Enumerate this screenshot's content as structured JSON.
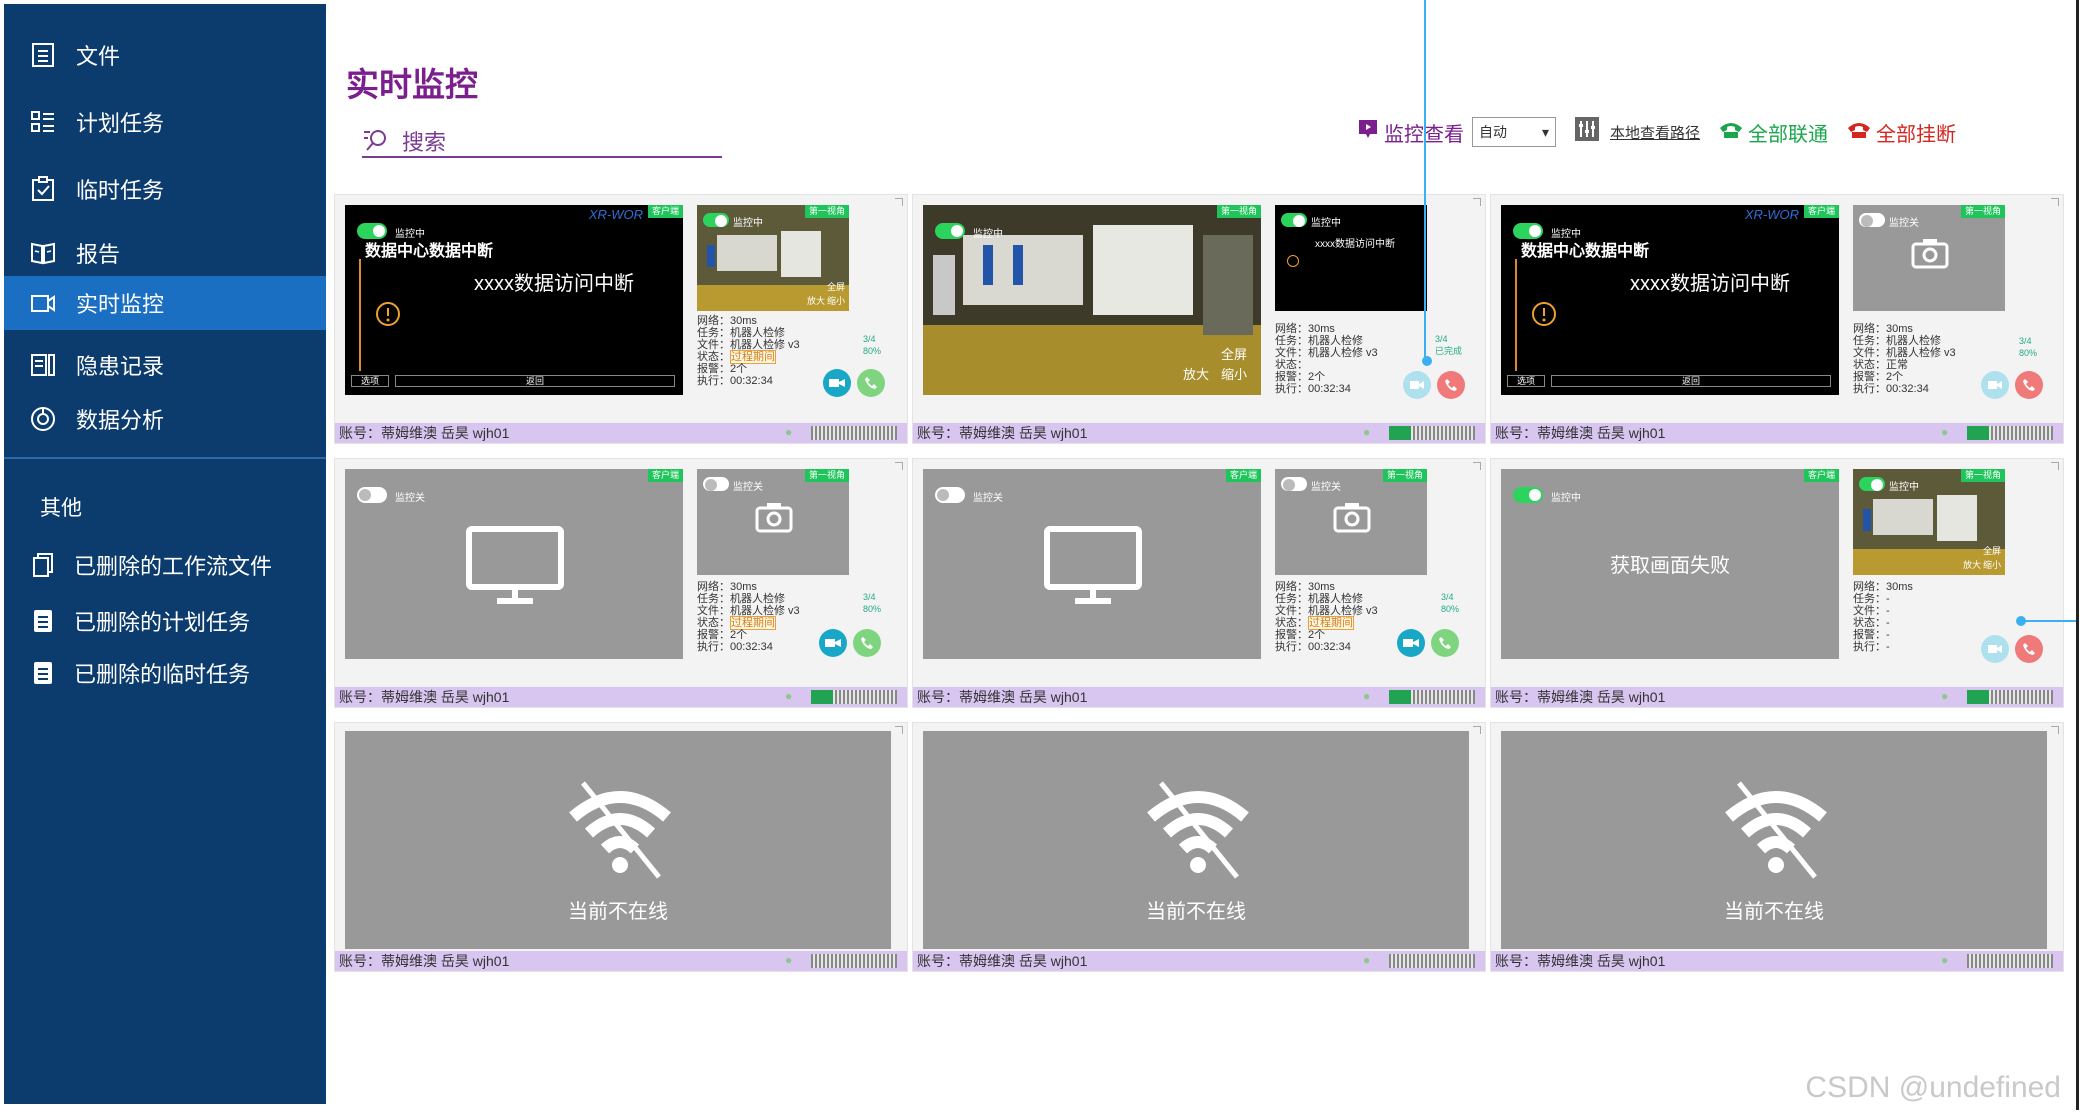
{
  "sidebar": {
    "items": [
      {
        "label": "文件",
        "icon": "document-list-icon"
      },
      {
        "label": "计划任务",
        "icon": "task-list-icon"
      },
      {
        "label": "临时任务",
        "icon": "clipboard-check-icon"
      },
      {
        "label": "报告",
        "icon": "book-icon"
      },
      {
        "label": "实时监控",
        "icon": "video-camera-icon",
        "active": true
      },
      {
        "label": "隐患记录",
        "icon": "record-icon"
      },
      {
        "label": "数据分析",
        "icon": "analysis-icon"
      }
    ],
    "other_header": "其他",
    "other_items": [
      {
        "label": "已删除的工作流文件",
        "icon": "copy-file-icon"
      },
      {
        "label": "已删除的计划任务",
        "icon": "file-icon"
      },
      {
        "label": "已删除的临时任务",
        "icon": "file-icon"
      }
    ]
  },
  "header": {
    "title": "实时监控"
  },
  "search": {
    "label": "搜索",
    "value": ""
  },
  "toolbar": {
    "monitor_view_label": "监控查看",
    "monitor_view_value": "自动",
    "local_path_label": "本地查看路径",
    "connect_all_label": "全部联通",
    "hangup_all_label": "全部挂断"
  },
  "cards": [
    {
      "account": "账号：蒂姆维澳 岳昊  wjh01",
      "main_message": "xxxx数据访问中断",
      "main_title": "数据中心数据中断",
      "main_brand": "XR-WOR",
      "main_tag": "客户端",
      "main_status": "监控中",
      "main_btn_left": "选项",
      "main_btn_right": "返回",
      "small_tag": "第一视角",
      "small_status": "监控中",
      "small_zoom_in": "放大",
      "small_zoom_out": "缩小",
      "small_full": "全屏",
      "info": {
        "net": "网络：30ms",
        "task": "任务：机器人检修",
        "file": "文件：机器人检修 v3",
        "state_label": "状态：",
        "state_value": "过程期间",
        "alarm": "报警：2个",
        "exec": "执行：00:32:34"
      },
      "progress": "3/4",
      "percent": "80%"
    },
    {
      "account": "账号：蒂姆维澳 岳昊  wjh01",
      "main_tag": "第一视角",
      "main_status": "监控中",
      "main_zoom_in": "放大",
      "main_zoom_out": "缩小",
      "main_full": "全屏",
      "small_status": "监控中",
      "small_message": "xxxx数据访问中断",
      "info": {
        "net": "网络：30ms",
        "task": "任务：机器人检修",
        "file": "文件：机器人检修 v3",
        "state_label": "状态：",
        "state_value": "",
        "alarm": "报警：2个",
        "exec": "执行：00:32:34"
      },
      "progress": "3/4",
      "percent": "已完成"
    },
    {
      "account": "账号：蒂姆维澳 岳昊  wjh01",
      "main_message": "xxxx数据访问中断",
      "main_title": "数据中心数据中断",
      "main_brand": "XR-WOR",
      "main_tag": "客户端",
      "main_status": "监控中",
      "main_btn_left": "选项",
      "main_btn_right": "返回",
      "small_tag": "第一视角",
      "small_status": "监控关",
      "info": {
        "net": "网络：30ms",
        "task": "任务：机器人检修",
        "file": "文件：机器人检修 v3",
        "state_label": "状态：正常",
        "state_value": "",
        "alarm": "报警：2个",
        "exec": "执行：00:32:34"
      },
      "progress": "3/4",
      "percent": "80%"
    },
    {
      "account": "账号：蒂姆维澳 岳昊  wjh01",
      "main_tag": "客户端",
      "main_status": "监控关",
      "small_tag": "第一视角",
      "small_status": "监控关",
      "info": {
        "net": "网络：30ms",
        "task": "任务：机器人检修",
        "file": "文件：机器人检修 v3",
        "state_label": "状态：",
        "state_value": "过程期间",
        "alarm": "报警：2个",
        "exec": "执行：00:32:34"
      },
      "progress": "3/4",
      "percent": "80%"
    },
    {
      "account": "账号：蒂姆维澳 岳昊  wjh01",
      "main_tag": "客户端",
      "main_status": "监控关",
      "small_tag": "第一视角",
      "small_status": "监控关",
      "info": {
        "net": "网络：30ms",
        "task": "任务：机器人检修",
        "file": "文件：机器人检修 v3",
        "state_label": "状态：",
        "state_value": "过程期间",
        "alarm": "报警：2个",
        "exec": "执行：00:32:34"
      },
      "progress": "3/4",
      "percent": "80%"
    },
    {
      "account": "账号：蒂姆维澳 岳昊  wjh01",
      "main_tag": "客户端",
      "main_status": "监控中",
      "main_message": "获取画面失败",
      "small_tag": "第一视角",
      "small_status": "监控中",
      "small_zoom_in": "放大",
      "small_zoom_out": "缩小",
      "small_full": "全屏",
      "info": {
        "net": "网络：30ms",
        "task": "任务：-",
        "file": "文件：-",
        "state_label": "状态：-",
        "state_value": "",
        "alarm": "报警：-",
        "exec": "执行：-"
      },
      "progress": "",
      "percent": ""
    },
    {
      "account": "账号：蒂姆维澳 岳昊  wjh01",
      "offline_message": "当前不在线"
    },
    {
      "account": "账号：蒂姆维澳 岳昊  wjh01",
      "offline_message": "当前不在线"
    },
    {
      "account": "账号：蒂姆维澳 岳昊  wjh01",
      "offline_message": "当前不在线"
    }
  ],
  "watermark": "CSDN @undefined",
  "colors": {
    "sidebar_bg": "#0c3c6d",
    "sidebar_active": "#1a6fc2",
    "title": "#7b1f8f",
    "footer": "#d8c5f0",
    "green": "#1fc45a"
  }
}
